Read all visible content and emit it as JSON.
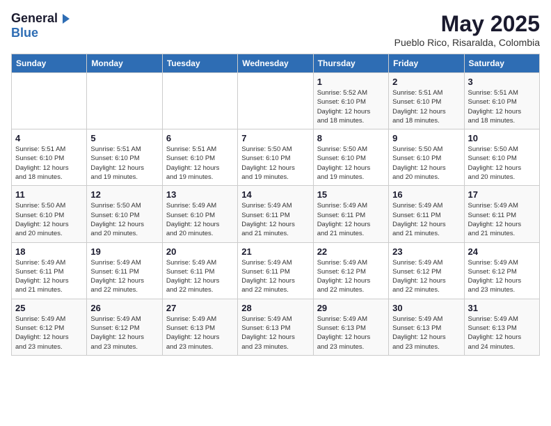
{
  "header": {
    "logo_general": "General",
    "logo_blue": "Blue",
    "month_year": "May 2025",
    "location": "Pueblo Rico, Risaralda, Colombia"
  },
  "weekdays": [
    "Sunday",
    "Monday",
    "Tuesday",
    "Wednesday",
    "Thursday",
    "Friday",
    "Saturday"
  ],
  "weeks": [
    [
      {
        "day": "",
        "info": ""
      },
      {
        "day": "",
        "info": ""
      },
      {
        "day": "",
        "info": ""
      },
      {
        "day": "",
        "info": ""
      },
      {
        "day": "1",
        "info": "Sunrise: 5:52 AM\nSunset: 6:10 PM\nDaylight: 12 hours\nand 18 minutes."
      },
      {
        "day": "2",
        "info": "Sunrise: 5:51 AM\nSunset: 6:10 PM\nDaylight: 12 hours\nand 18 minutes."
      },
      {
        "day": "3",
        "info": "Sunrise: 5:51 AM\nSunset: 6:10 PM\nDaylight: 12 hours\nand 18 minutes."
      }
    ],
    [
      {
        "day": "4",
        "info": "Sunrise: 5:51 AM\nSunset: 6:10 PM\nDaylight: 12 hours\nand 18 minutes."
      },
      {
        "day": "5",
        "info": "Sunrise: 5:51 AM\nSunset: 6:10 PM\nDaylight: 12 hours\nand 19 minutes."
      },
      {
        "day": "6",
        "info": "Sunrise: 5:51 AM\nSunset: 6:10 PM\nDaylight: 12 hours\nand 19 minutes."
      },
      {
        "day": "7",
        "info": "Sunrise: 5:50 AM\nSunset: 6:10 PM\nDaylight: 12 hours\nand 19 minutes."
      },
      {
        "day": "8",
        "info": "Sunrise: 5:50 AM\nSunset: 6:10 PM\nDaylight: 12 hours\nand 19 minutes."
      },
      {
        "day": "9",
        "info": "Sunrise: 5:50 AM\nSunset: 6:10 PM\nDaylight: 12 hours\nand 20 minutes."
      },
      {
        "day": "10",
        "info": "Sunrise: 5:50 AM\nSunset: 6:10 PM\nDaylight: 12 hours\nand 20 minutes."
      }
    ],
    [
      {
        "day": "11",
        "info": "Sunrise: 5:50 AM\nSunset: 6:10 PM\nDaylight: 12 hours\nand 20 minutes."
      },
      {
        "day": "12",
        "info": "Sunrise: 5:50 AM\nSunset: 6:10 PM\nDaylight: 12 hours\nand 20 minutes."
      },
      {
        "day": "13",
        "info": "Sunrise: 5:49 AM\nSunset: 6:10 PM\nDaylight: 12 hours\nand 20 minutes."
      },
      {
        "day": "14",
        "info": "Sunrise: 5:49 AM\nSunset: 6:11 PM\nDaylight: 12 hours\nand 21 minutes."
      },
      {
        "day": "15",
        "info": "Sunrise: 5:49 AM\nSunset: 6:11 PM\nDaylight: 12 hours\nand 21 minutes."
      },
      {
        "day": "16",
        "info": "Sunrise: 5:49 AM\nSunset: 6:11 PM\nDaylight: 12 hours\nand 21 minutes."
      },
      {
        "day": "17",
        "info": "Sunrise: 5:49 AM\nSunset: 6:11 PM\nDaylight: 12 hours\nand 21 minutes."
      }
    ],
    [
      {
        "day": "18",
        "info": "Sunrise: 5:49 AM\nSunset: 6:11 PM\nDaylight: 12 hours\nand 21 minutes."
      },
      {
        "day": "19",
        "info": "Sunrise: 5:49 AM\nSunset: 6:11 PM\nDaylight: 12 hours\nand 22 minutes."
      },
      {
        "day": "20",
        "info": "Sunrise: 5:49 AM\nSunset: 6:11 PM\nDaylight: 12 hours\nand 22 minutes."
      },
      {
        "day": "21",
        "info": "Sunrise: 5:49 AM\nSunset: 6:11 PM\nDaylight: 12 hours\nand 22 minutes."
      },
      {
        "day": "22",
        "info": "Sunrise: 5:49 AM\nSunset: 6:12 PM\nDaylight: 12 hours\nand 22 minutes."
      },
      {
        "day": "23",
        "info": "Sunrise: 5:49 AM\nSunset: 6:12 PM\nDaylight: 12 hours\nand 22 minutes."
      },
      {
        "day": "24",
        "info": "Sunrise: 5:49 AM\nSunset: 6:12 PM\nDaylight: 12 hours\nand 23 minutes."
      }
    ],
    [
      {
        "day": "25",
        "info": "Sunrise: 5:49 AM\nSunset: 6:12 PM\nDaylight: 12 hours\nand 23 minutes."
      },
      {
        "day": "26",
        "info": "Sunrise: 5:49 AM\nSunset: 6:12 PM\nDaylight: 12 hours\nand 23 minutes."
      },
      {
        "day": "27",
        "info": "Sunrise: 5:49 AM\nSunset: 6:13 PM\nDaylight: 12 hours\nand 23 minutes."
      },
      {
        "day": "28",
        "info": "Sunrise: 5:49 AM\nSunset: 6:13 PM\nDaylight: 12 hours\nand 23 minutes."
      },
      {
        "day": "29",
        "info": "Sunrise: 5:49 AM\nSunset: 6:13 PM\nDaylight: 12 hours\nand 23 minutes."
      },
      {
        "day": "30",
        "info": "Sunrise: 5:49 AM\nSunset: 6:13 PM\nDaylight: 12 hours\nand 23 minutes."
      },
      {
        "day": "31",
        "info": "Sunrise: 5:49 AM\nSunset: 6:13 PM\nDaylight: 12 hours\nand 24 minutes."
      }
    ]
  ]
}
